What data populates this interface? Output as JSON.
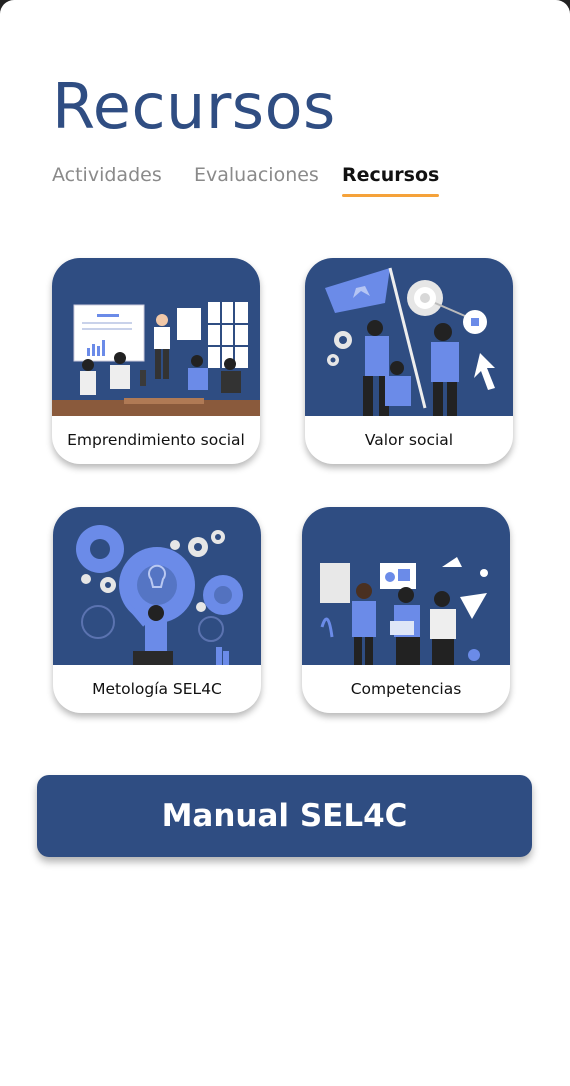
{
  "header": {
    "title": "Recursos"
  },
  "tabs": [
    {
      "label": "Actividades",
      "active": false
    },
    {
      "label": "Evaluaciones",
      "active": false
    },
    {
      "label": "Recursos",
      "active": true
    }
  ],
  "cards": [
    {
      "label": "Emprendimiento social",
      "icon": "presentation-illustration"
    },
    {
      "label": "Valor social",
      "icon": "team-flag-illustration"
    },
    {
      "label": "Metología SEL4C",
      "icon": "gears-lightbulb-illustration"
    },
    {
      "label": "Competencias",
      "icon": "team-rocket-illustration"
    }
  ],
  "manual_button": {
    "label": "Manual SEL4C"
  },
  "colors": {
    "primary": "#2f4d82",
    "accent": "#f5a23a",
    "illustration_blue": "#6b8be8"
  }
}
